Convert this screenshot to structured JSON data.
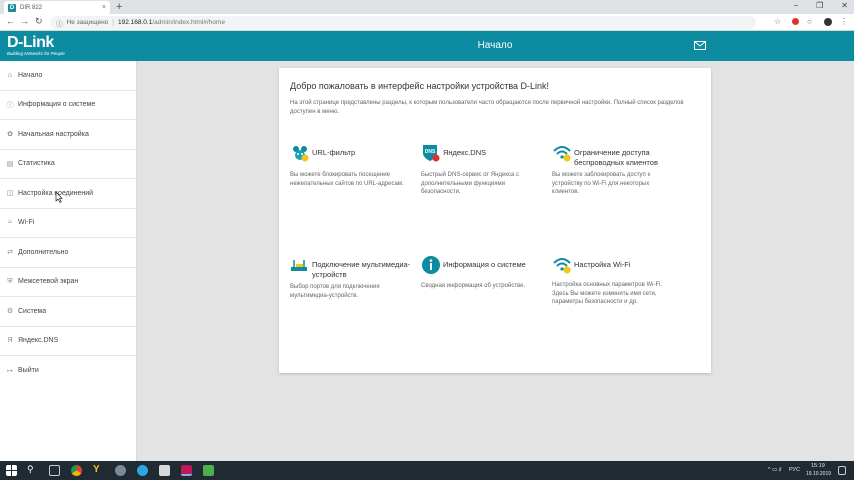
{
  "browser": {
    "tab_title": "DIR 822",
    "tab_close": "×",
    "new_tab": "+",
    "security": "Не защищено",
    "url_host": "192.168.0.1",
    "url_path": "/admin/index.html#/home",
    "window_buttons": [
      "−",
      "❐",
      "✕"
    ]
  },
  "header": {
    "logo": "D-Link",
    "logo_tagline": "Building Networks for People",
    "title": "Начало"
  },
  "sidebar": {
    "items": [
      {
        "label": "Начало",
        "icon": "home-icon"
      },
      {
        "label": "Информация о системе",
        "icon": "info-icon"
      },
      {
        "label": "Начальная настройка",
        "icon": "wand-icon"
      },
      {
        "label": "Статистика",
        "icon": "stats-icon"
      },
      {
        "label": "Настройка соединений",
        "icon": "connections-icon"
      },
      {
        "label": "Wi-Fi",
        "icon": "wifi-icon"
      },
      {
        "label": "Дополнительно",
        "icon": "advanced-icon"
      },
      {
        "label": "Межсетевой экран",
        "icon": "firewall-icon"
      },
      {
        "label": "Система",
        "icon": "system-icon"
      },
      {
        "label": "Яндекс.DNS",
        "icon": "yandex-icon"
      },
      {
        "label": "Выйти",
        "icon": "logout-icon"
      }
    ]
  },
  "main": {
    "welcome": "Добро пожаловать в интерфейс настройки устройства D-Link!",
    "intro": "На этой странице представлены разделы, к которым пользователи часто обращаются после первичной настройки. Полный список разделов доступен в меню.",
    "tiles": [
      {
        "title": "URL-фильтр",
        "desc": "Вы можете блокировать посещение нежелательных сайтов по URL-адресам.",
        "icon": "url-filter-icon"
      },
      {
        "title": "Яндекс.DNS",
        "desc": "Быстрый DNS-сервис от Яндекса с дополнительными функциями безопасности.",
        "icon": "yandex-dns-icon",
        "badge": "DNS"
      },
      {
        "title": "Ограничение доступа беспроводных клиентов",
        "desc": "Вы можете заблокировать доступ к устройству по Wi-Fi для некоторых клиентов.",
        "icon": "wifi-restrict-icon"
      },
      {
        "title": "Подключение мультимедиа-устройств",
        "desc": "Выбор портов для подключения мультимедиа-устройств.",
        "icon": "multimedia-icon"
      },
      {
        "title": "Информация о системе",
        "desc": "Сводная информация об устройстве.",
        "icon": "system-info-icon"
      },
      {
        "title": "Настройка Wi-Fi",
        "desc": "Настройка основных параметров Wi-Fi. Здесь Вы можете изменить имя сети, параметры безопасности и др.",
        "icon": "wifi-settings-icon"
      }
    ]
  },
  "taskbar": {
    "lang": "РУС",
    "time": "15:19",
    "date": "19.10.2019"
  },
  "colors": {
    "accent": "#0d8ba1",
    "accent_light": "#17a2b8",
    "yellow": "#f5c518",
    "taskbar": "#1f2a33"
  }
}
